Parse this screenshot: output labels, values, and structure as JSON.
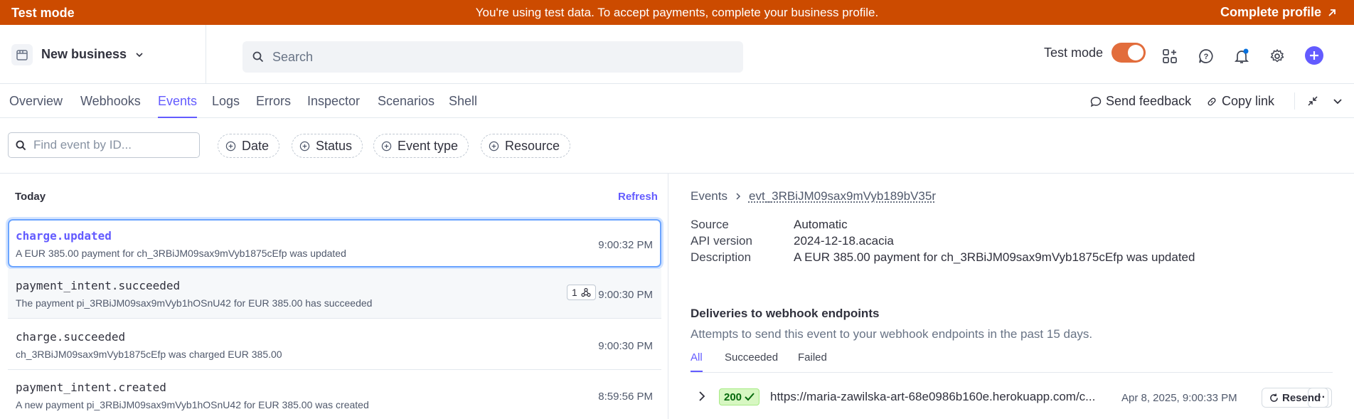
{
  "banner": {
    "mode_label": "Test mode",
    "message": "You're using test data. To accept payments, complete your business profile.",
    "cta_label": "Complete profile"
  },
  "header": {
    "business_name": "New business",
    "search_placeholder": "Search",
    "test_mode_label": "Test mode",
    "test_mode_on": true,
    "icons": [
      "store-icon",
      "chevron-down-icon",
      "search-icon",
      "apps-icon",
      "help-icon",
      "bell-icon",
      "gear-icon",
      "plus-icon"
    ]
  },
  "tabs": {
    "items": [
      "Overview",
      "Webhooks",
      "Events",
      "Logs",
      "Errors",
      "Inspector",
      "Scenarios",
      "Shell"
    ],
    "active": "Events",
    "send_feedback": "Send feedback",
    "copy_link": "Copy link"
  },
  "filters": {
    "find_placeholder": "Find event by ID...",
    "chips": [
      "Date",
      "Status",
      "Event type",
      "Resource"
    ]
  },
  "events": {
    "group_label": "Today",
    "refresh_label": "Refresh",
    "rows": [
      {
        "type": "charge.updated",
        "desc": "A EUR 385.00 payment for ch_3RBiJM09sax9mVyb1875cEfp was updated",
        "time": "9:00:32 PM"
      },
      {
        "type": "payment_intent.succeeded",
        "desc": "The payment pi_3RBiJM09sax9mVyb1hOSnU42 for EUR 385.00 has succeeded",
        "time": "9:00:30 PM",
        "badge": "1"
      },
      {
        "type": "charge.succeeded",
        "desc": "ch_3RBiJM09sax9mVyb1875cEfp was charged EUR 385.00",
        "time": "9:00:30 PM"
      },
      {
        "type": "payment_intent.created",
        "desc": "A new payment pi_3RBiJM09sax9mVyb1hOSnU42 for EUR 385.00 was created",
        "time": "8:59:56 PM"
      }
    ]
  },
  "detail": {
    "breadcrumb_root": "Events",
    "event_id": "evt_3RBiJM09sax9mVyb189bV35r",
    "source_label": "Source",
    "source_value": "Automatic",
    "api_label": "API version",
    "api_value": "2024-12-18.acacia",
    "description_label": "Description",
    "description_value": "A EUR 385.00 payment for ch_3RBiJM09sax9mVyb1875cEfp was updated",
    "deliveries_title": "Deliveries to webhook endpoints",
    "deliveries_subtitle": "Attempts to send this event to your webhook endpoints in the past 15 days.",
    "subtabs": [
      "All",
      "Succeeded",
      "Failed"
    ],
    "delivery": {
      "status_code": "200",
      "endpoint": "https://maria-zawilska-art-68e0986b160e.herokuapp.com/c...",
      "time": "Apr 8, 2025, 9:00:33 PM",
      "resend_label": "Resend",
      "more_label": "···"
    }
  },
  "colors": {
    "banner": "#cc4b00",
    "accent": "#635bff",
    "success_bg": "#d7f7c2",
    "success_text": "#05690d"
  }
}
